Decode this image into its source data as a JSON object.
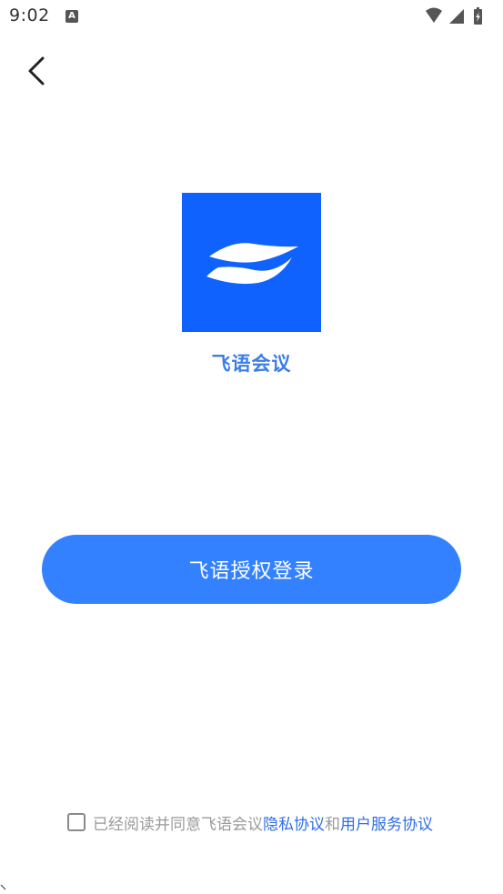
{
  "status_bar": {
    "time": "9:02",
    "notification_glyph": "A",
    "icons": [
      "wifi-icon",
      "cell-signal-icon",
      "battery-charging-icon"
    ]
  },
  "nav": {
    "back_icon": "chevron-left-icon"
  },
  "app": {
    "name": "飞语会议",
    "logo_icon": "feiyu-logo-icon",
    "brand_color": "#0f62fe"
  },
  "login": {
    "button_label": "飞语授权登录",
    "button_color": "#3381ff"
  },
  "agreement": {
    "checked": false,
    "prefix": "已经阅读并同意飞语会议",
    "privacy_link": "隐私协议",
    "conjunction": "和",
    "service_link": "用户服务协议",
    "link_color": "#2f6ee6"
  }
}
